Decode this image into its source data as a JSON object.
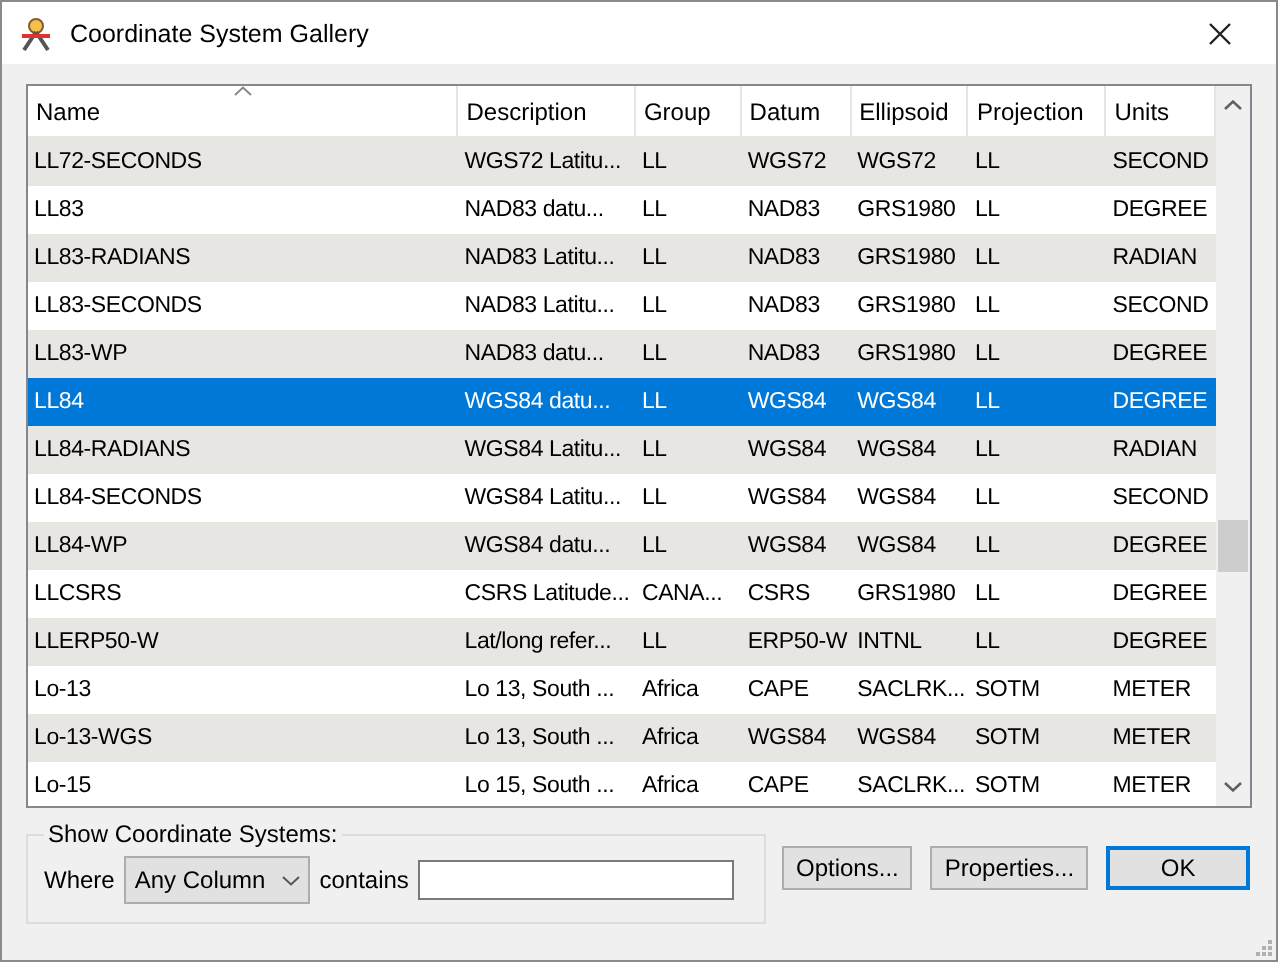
{
  "window": {
    "title": "Coordinate System Gallery"
  },
  "table": {
    "columns": [
      {
        "label": "Name",
        "sorted": true
      },
      {
        "label": "Description",
        "sorted": false
      },
      {
        "label": "Group",
        "sorted": false
      },
      {
        "label": "Datum",
        "sorted": false
      },
      {
        "label": "Ellipsoid",
        "sorted": false
      },
      {
        "label": "Projection",
        "sorted": false
      },
      {
        "label": "Units",
        "sorted": false
      }
    ],
    "rows": [
      {
        "cells": [
          "LL72-SECONDS",
          "WGS72 Latitu...",
          "LL",
          "WGS72",
          "WGS72",
          "LL",
          "SECOND"
        ],
        "selected": false
      },
      {
        "cells": [
          "LL83",
          "NAD83 datu...",
          "LL",
          "NAD83",
          "GRS1980",
          "LL",
          "DEGREE"
        ],
        "selected": false
      },
      {
        "cells": [
          "LL83-RADIANS",
          "NAD83 Latitu...",
          "LL",
          "NAD83",
          "GRS1980",
          "LL",
          "RADIAN"
        ],
        "selected": false
      },
      {
        "cells": [
          "LL83-SECONDS",
          "NAD83 Latitu...",
          "LL",
          "NAD83",
          "GRS1980",
          "LL",
          "SECOND"
        ],
        "selected": false
      },
      {
        "cells": [
          "LL83-WP",
          "NAD83 datu...",
          "LL",
          "NAD83",
          "GRS1980",
          "LL",
          "DEGREE"
        ],
        "selected": false
      },
      {
        "cells": [
          "LL84",
          "WGS84 datu...",
          "LL",
          "WGS84",
          "WGS84",
          "LL",
          "DEGREE"
        ],
        "selected": true
      },
      {
        "cells": [
          "LL84-RADIANS",
          "WGS84 Latitu...",
          "LL",
          "WGS84",
          "WGS84",
          "LL",
          "RADIAN"
        ],
        "selected": false
      },
      {
        "cells": [
          "LL84-SECONDS",
          "WGS84 Latitu...",
          "LL",
          "WGS84",
          "WGS84",
          "LL",
          "SECOND"
        ],
        "selected": false
      },
      {
        "cells": [
          "LL84-WP",
          "WGS84 datu...",
          "LL",
          "WGS84",
          "WGS84",
          "LL",
          "DEGREE"
        ],
        "selected": false
      },
      {
        "cells": [
          "LLCSRS",
          "CSRS Latitude...",
          "CANA...",
          "CSRS",
          "GRS1980",
          "LL",
          "DEGREE"
        ],
        "selected": false
      },
      {
        "cells": [
          "LLERP50-W",
          "Lat/long refer...",
          "LL",
          "ERP50-W",
          "INTNL",
          "LL",
          "DEGREE"
        ],
        "selected": false
      },
      {
        "cells": [
          "Lo-13",
          "Lo 13, South ...",
          "Africa",
          "CAPE",
          "SACLRK...",
          "SOTM",
          "METER"
        ],
        "selected": false
      },
      {
        "cells": [
          "Lo-13-WGS",
          "Lo 13, South ...",
          "Africa",
          "WGS84",
          "WGS84",
          "SOTM",
          "METER"
        ],
        "selected": false
      },
      {
        "cells": [
          "Lo-15",
          "Lo 15, South ...",
          "Africa",
          "CAPE",
          "SACLRK...",
          "SOTM",
          "METER"
        ],
        "selected": false
      }
    ]
  },
  "filter": {
    "title": "Show Coordinate Systems:",
    "where_label": "Where",
    "column_choice": "Any Column",
    "contains_label": "contains"
  },
  "buttons": [
    {
      "label": "Options...",
      "default": false
    },
    {
      "label": "Properties...",
      "default": false
    },
    {
      "label": "OK",
      "default": true
    }
  ]
}
